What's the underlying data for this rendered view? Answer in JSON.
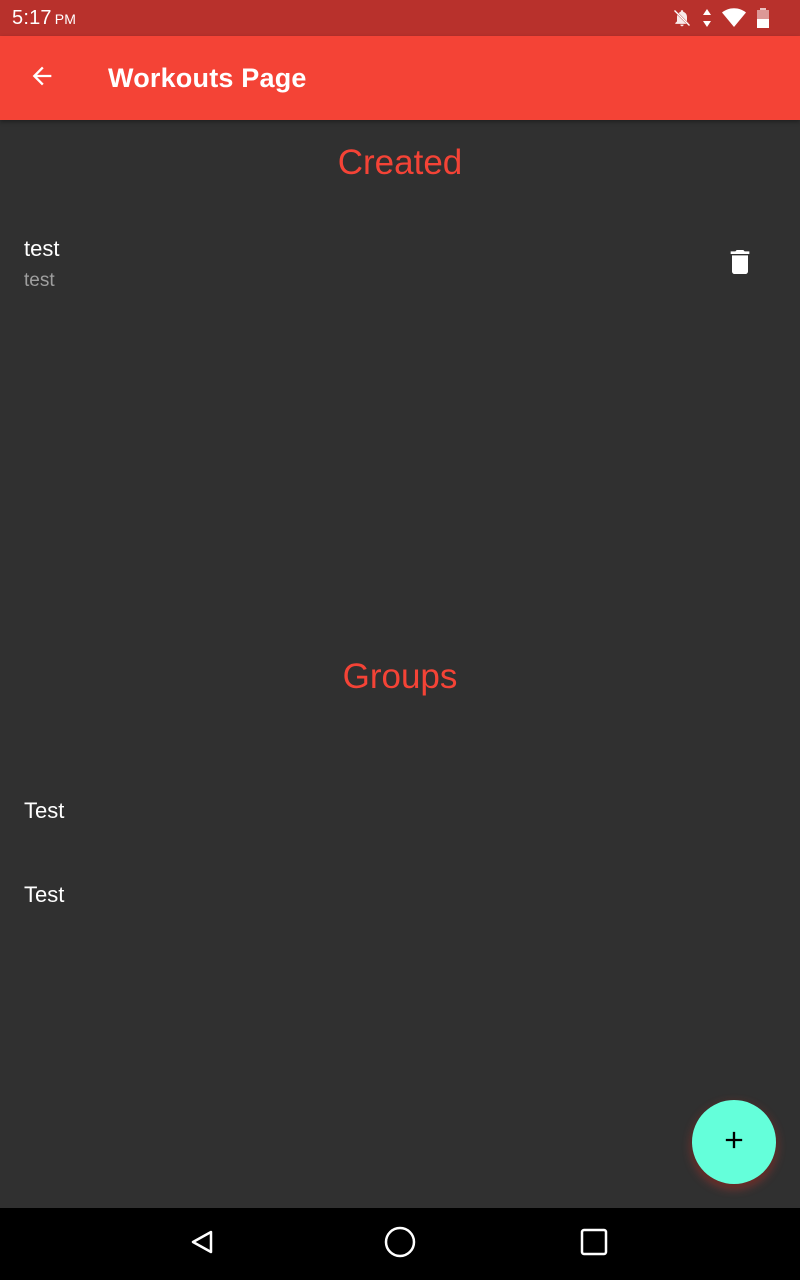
{
  "status_bar": {
    "time": "5:17",
    "ampm": "PM",
    "icons": [
      "notifications-off-icon",
      "data-arrows-icon",
      "wifi-icon",
      "battery-icon"
    ]
  },
  "app_bar": {
    "title": "Workouts Page",
    "back_icon": "arrow-back-icon"
  },
  "created": {
    "heading": "Created",
    "items": [
      {
        "title": "test",
        "subtitle": "test",
        "action_icon": "delete-icon"
      }
    ]
  },
  "groups": {
    "heading": "Groups",
    "items": [
      {
        "label": "Test"
      },
      {
        "label": "Test"
      }
    ]
  },
  "fab": {
    "icon": "add-icon"
  },
  "nav_bar": {
    "icons": [
      "nav-back-icon",
      "nav-home-icon",
      "nav-recents-icon"
    ]
  },
  "colors": {
    "primary": "#f44336",
    "status_bar": "#b8312c",
    "background": "#303030",
    "accent": "#64ffda",
    "subtitle": "#9e9e9e"
  }
}
